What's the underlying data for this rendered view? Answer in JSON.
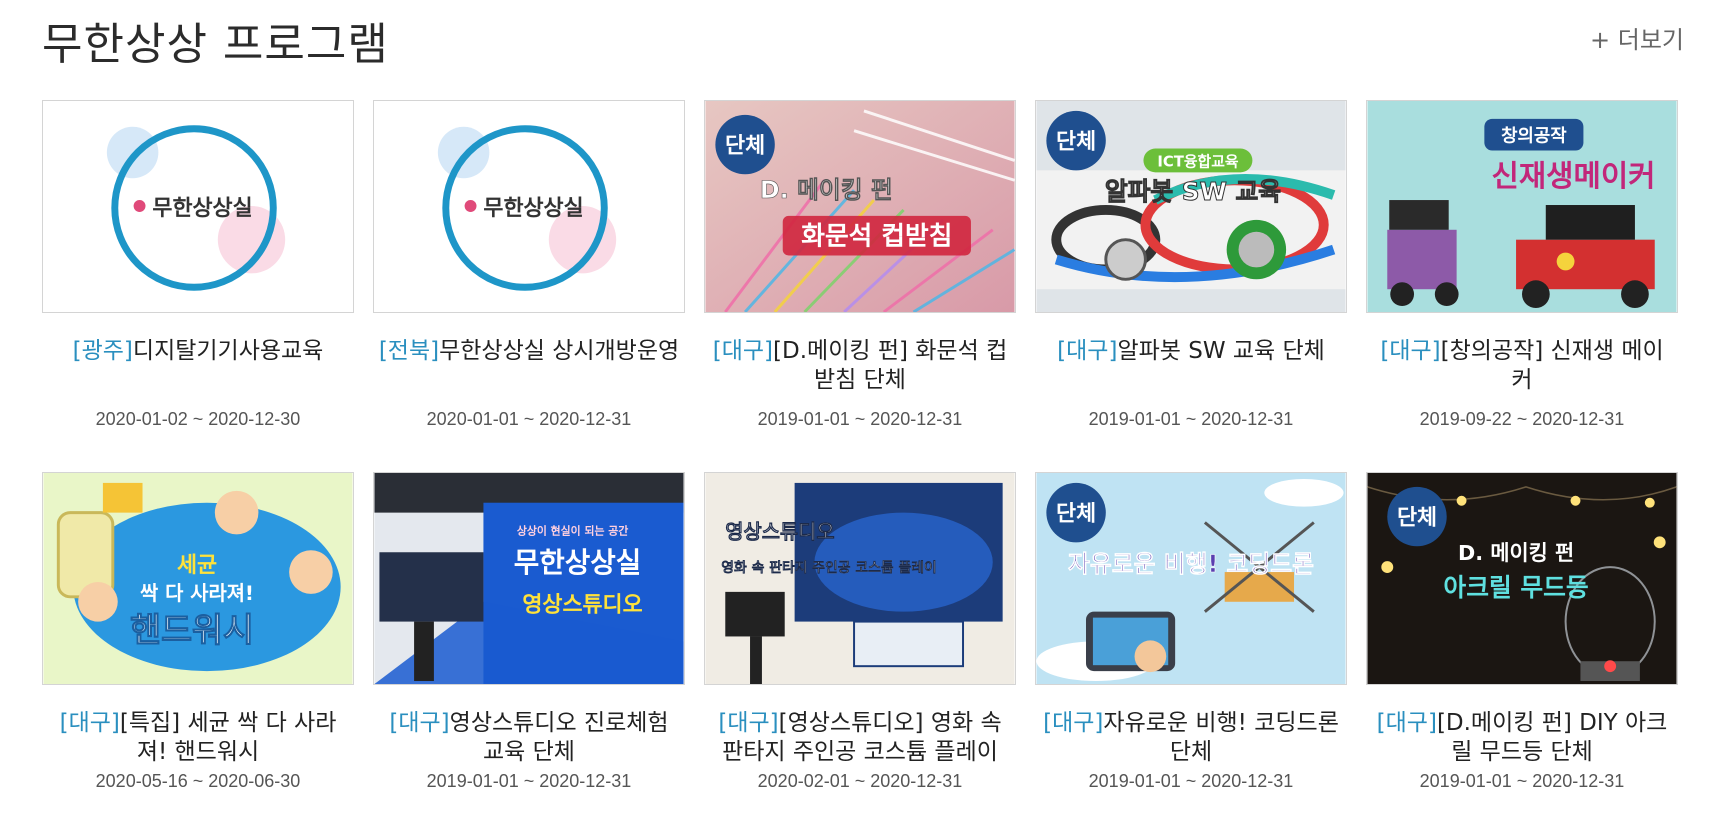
{
  "section": {
    "title": "무한상상 프로그램",
    "more_label": "+ 더보기"
  },
  "colors": {
    "region": "#2a8fbf",
    "badge": "#1f4f8f",
    "logo_ring": "#1e96c8"
  },
  "cards": [
    {
      "region": "[광주]",
      "title": "디지탈기기사용교육",
      "date": "2020-01-02 ~ 2020-12-30",
      "thumb": {
        "logo": "무한상상실"
      }
    },
    {
      "region": "[전북]",
      "title": "무한상상실 상시개방운영",
      "date": "2020-01-01 ~ 2020-12-31",
      "thumb": {
        "logo": "무한상상실"
      }
    },
    {
      "region": "[대구]",
      "title": "[D.메이킹 펀] 화문석 컵받침 단체",
      "date": "2019-01-01 ~ 2020-12-31",
      "thumb": {
        "badge": "단체",
        "line1": "D. 메이킹 펀",
        "line2": "화문석 컵받침"
      }
    },
    {
      "region": "[대구]",
      "title": "알파봇 SW 교육 단체",
      "date": "2019-01-01 ~ 2020-12-31",
      "thumb": {
        "badge": "단체",
        "tag": "ICT융합교육",
        "line1": "알파봇 SW 교육"
      }
    },
    {
      "region": "[대구]",
      "title": "[창의공작] 신재생 메이커",
      "date": "2019-09-22 ~ 2020-12-31",
      "thumb": {
        "tag": "창의공작",
        "line1": "신재생메이커"
      }
    },
    {
      "region": "[대구]",
      "title": "[특집] 세균 싹 다 사라져! 핸드워시",
      "date": "2020-05-16 ~ 2020-06-30",
      "thumb": {
        "line1": "세균",
        "line2": "싹 다 사라져!",
        "line3": "핸드워시"
      }
    },
    {
      "region": "[대구]",
      "title": "영상스튜디오 진로체험 교육 단체",
      "date": "2019-01-01 ~ 2020-12-31",
      "thumb": {
        "small": "상상이 현실이 되는 공간",
        "line1": "무한상상실",
        "line2": "영상스튜디오"
      }
    },
    {
      "region": "[대구]",
      "title": "[영상스튜디오] 영화 속 판타지 주인공 코스튬 플레이",
      "date": "2020-02-01 ~ 2020-12-31",
      "thumb": {
        "line1": "영상스튜디오",
        "line2": "영화 속 판타지 주인공 코스튬 플레이"
      }
    },
    {
      "region": "[대구]",
      "title": "자유로운 비행! 코딩드론 단체",
      "date": "2019-01-01 ~ 2020-12-31",
      "thumb": {
        "badge": "단체",
        "line1": "자유로운 비행! 코딩드론"
      }
    },
    {
      "region": "[대구]",
      "title": "[D.메이킹 펀] DIY 아크릴 무드등 단체",
      "date": "2019-01-01 ~ 2020-12-31",
      "thumb": {
        "badge": "단체",
        "line1": "D. 메이킹 펀",
        "line2": "아크릴 무드등"
      }
    }
  ]
}
